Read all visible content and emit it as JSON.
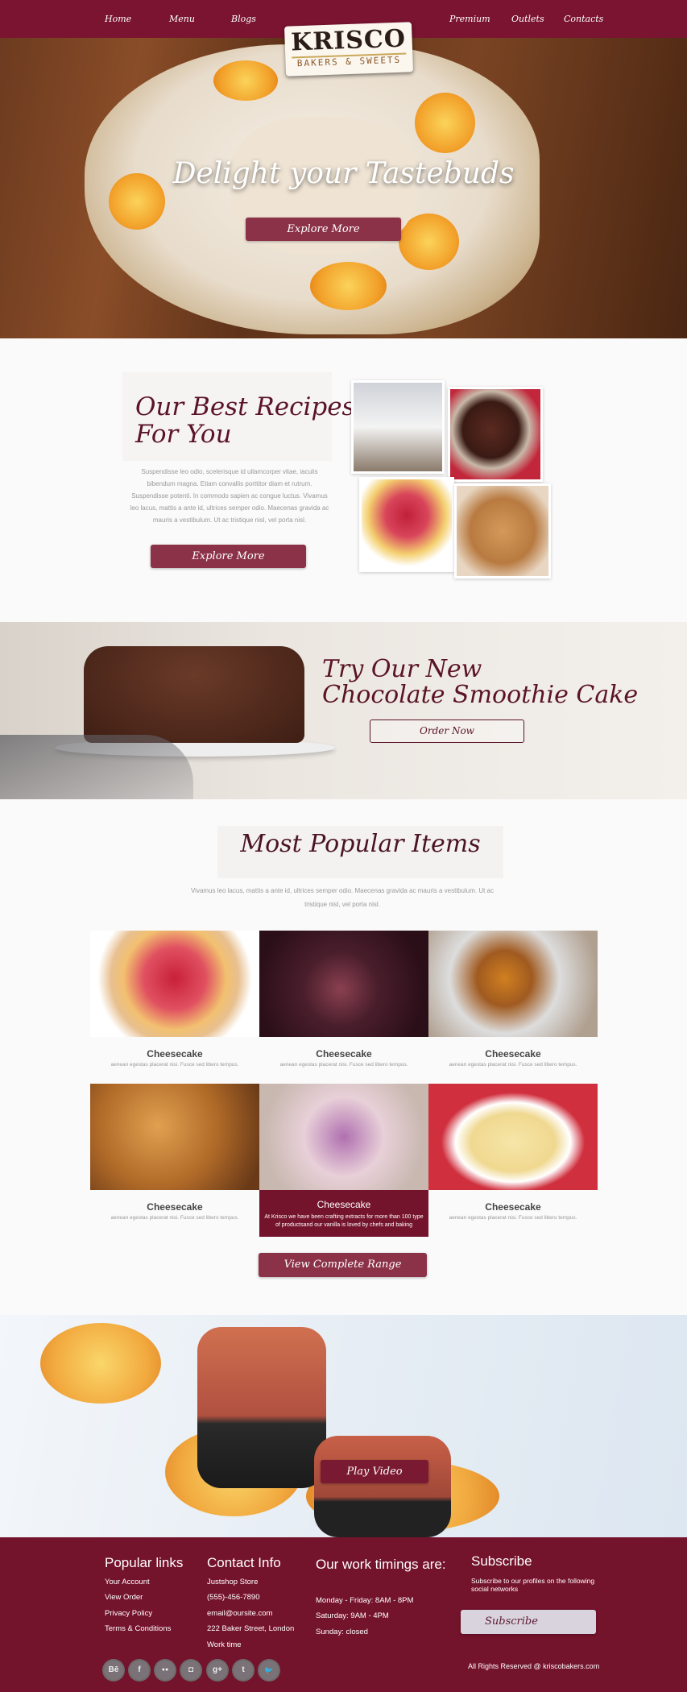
{
  "nav": {
    "left": [
      "Home",
      "Menu",
      "Blogs"
    ],
    "right": [
      "Premium",
      "Outlets",
      "Contacts"
    ]
  },
  "logo": {
    "name": "KRISCO",
    "tagline": "BAKERS & SWEETS"
  },
  "hero": {
    "title": "Delight your Tastebuds",
    "button": "Explore More"
  },
  "recipes": {
    "title_line1": "Our Best Recipes",
    "title_line2": "For You",
    "text": "Suspendisse leo odio, scelerisque id ullamcorper vitae, iaculis bibendum magna. Etiam convallis porttitor diam et rutrum. Suspendisse potenti. In commodo sapien ac congue luctus. Vivamus leo lacus, mattis a ante id, ultrices semper odio. Maecenas gravida ac mauris a vestibulum. Ut ac tristique nisl, vel porta nisl.",
    "button": "Explore More"
  },
  "promo": {
    "title_line1": "Try Our New",
    "title_line2": "Chocolate Smoothie Cake",
    "button": "Order Now"
  },
  "popular": {
    "title": "Most Popular Items",
    "text": "Vivamus leo lacus, mattis a ante id, ultrices semper odio. Maecenas gravida ac mauris a vestibulum. Ut ac tristique nisl, vel porta nisl.",
    "items": [
      {
        "title": "Cheesecake",
        "desc": "aenean egestas placerat nisi. Fusce sed libero tempus."
      },
      {
        "title": "Cheesecake",
        "desc": "aenean egestas placerat nisi. Fusce sed libero tempus."
      },
      {
        "title": "Cheesecake",
        "desc": "aenean egestas placerat nisi. Fusce sed libero tempus."
      },
      {
        "title": "Cheesecake",
        "desc": "aenean egestas placerat nisi. Fusce sed libero tempus."
      },
      {
        "title": "Cheesecake",
        "desc": "At Krisco we have been crafting extracts for more than 100 type of productsand our vanilla is loved by chefs and baking"
      },
      {
        "title": "Cheesecake",
        "desc": "aenean egestas placerat nisi. Fusce sed libero tempus."
      }
    ],
    "button": "View Complete Range"
  },
  "video": {
    "button": "Play Video"
  },
  "footer": {
    "popular": {
      "heading": "Popular links",
      "links": [
        "Your Account",
        "View Order",
        "Privacy Policy",
        "Terms & Conditions"
      ]
    },
    "contact": {
      "heading": "Contact Info",
      "lines": [
        "Justshop Store",
        "(555)-456-7890",
        "email@oursite.com",
        "222 Baker Street, London",
        "Work time"
      ]
    },
    "timings": {
      "heading": "Our work timings are:",
      "lines": [
        "Monday - Friday: 8AM - 8PM",
        "Saturday: 9AM - 4PM",
        "Sunday: closed"
      ]
    },
    "subscribe": {
      "heading": "Subscribe",
      "text": "Subscribe to our profiles on the following social networks",
      "button": "Subscribe"
    },
    "social": [
      "Bē",
      "f",
      "●●",
      "◘",
      "g+",
      "t",
      "🐦"
    ],
    "copyright": "All Rights Reserved @ kriscobakers.com"
  },
  "colors": {
    "brand": "#7a1430",
    "button": "#8c3248"
  }
}
